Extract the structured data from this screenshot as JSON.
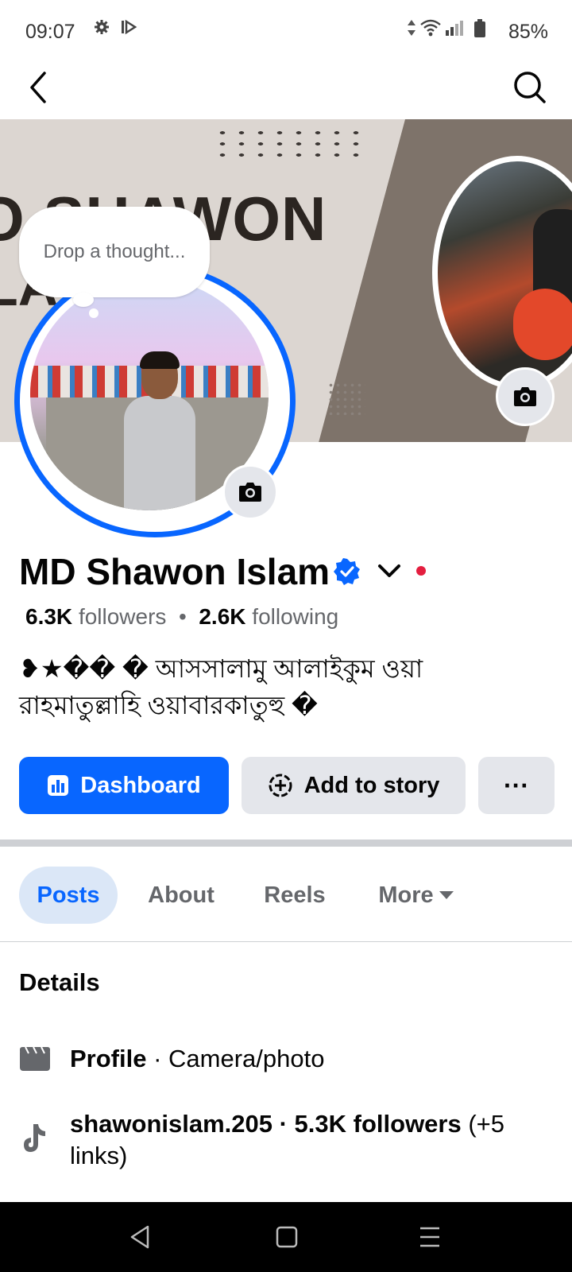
{
  "status_bar": {
    "time": "09:07",
    "battery": "85%",
    "icons": [
      "gear-icon",
      "media-icon",
      "data-arrows-icon",
      "wifi-icon",
      "signal-icon",
      "battery-icon"
    ]
  },
  "top_nav": {
    "back_icon": "back-arrow-icon",
    "search_icon": "search-icon"
  },
  "cover": {
    "text_line1": "O SHAWON",
    "text_line2": "LA"
  },
  "thought_bubble": {
    "placeholder": "Drop a thought..."
  },
  "profile": {
    "name": "MD Shawon Islam",
    "followers_count": "6.3K",
    "followers_label": "followers",
    "separator": "•",
    "following_count": "2.6K",
    "following_label": "following",
    "bio_line1": "❥★�� � আসসালামু আলাইকুম ওয়া",
    "bio_line2": "রাহমাতুল্লাহি ওয়াবারকাতুহু �"
  },
  "actions": {
    "dashboard_label": "Dashboard",
    "add_story_label": "Add to story",
    "more_label": "···"
  },
  "tabs": [
    {
      "label": "Posts",
      "active": true
    },
    {
      "label": "About",
      "active": false
    },
    {
      "label": "Reels",
      "active": false
    },
    {
      "label": "More",
      "active": false
    }
  ],
  "details": {
    "heading": "Details",
    "profile_label": "Profile",
    "profile_category": "· Camera/photo",
    "tiktok_text": "shawonislam.205 · 5.3K followers",
    "tiktok_links": "(+5 links)"
  },
  "colors": {
    "accent": "#0866ff",
    "verified": "#0866ff",
    "red_dot": "#e41e3f",
    "secondary_text": "#65676b",
    "button_grey": "#e4e6eb"
  }
}
